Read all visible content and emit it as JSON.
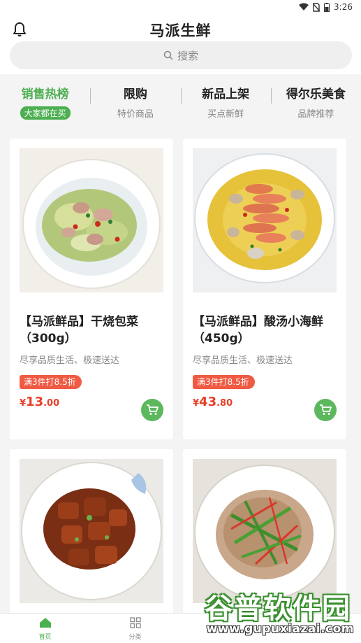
{
  "status_bar": {
    "time": "3:26"
  },
  "header": {
    "title": "马派生鲜",
    "search_placeholder": "搜索"
  },
  "categories": [
    {
      "title": "销售热榜",
      "subtitle": "大家都在买",
      "active": true
    },
    {
      "title": "限购",
      "subtitle": "特价商品",
      "active": false
    },
    {
      "title": "新品上架",
      "subtitle": "买点新鲜",
      "active": false
    },
    {
      "title": "得尔乐美食",
      "subtitle": "品牌推荐",
      "active": false
    }
  ],
  "products": [
    {
      "name": "【马派鲜品】干烧包菜（300g）",
      "desc": "尽享品质生活、极速送达",
      "promo": "满3件打8.5折",
      "currency": "¥",
      "price_int": "13",
      "price_dec": ".00"
    },
    {
      "name": "【马派鲜品】酸汤小海鲜（450g）",
      "desc": "尽享品质生活、极速送达",
      "promo": "满3件打8.5折",
      "currency": "¥",
      "price_int": "43",
      "price_dec": ".80"
    }
  ],
  "tabbar": [
    {
      "label": "首页",
      "icon": "home-icon",
      "active": true
    },
    {
      "label": "分类",
      "icon": "grid-icon",
      "active": false
    }
  ],
  "watermark": {
    "title": "谷普软件园",
    "url": "www.gupuxiazai.com"
  },
  "colors": {
    "accent": "#4caf50",
    "price": "#e8402a",
    "promo": "#f05a43"
  }
}
